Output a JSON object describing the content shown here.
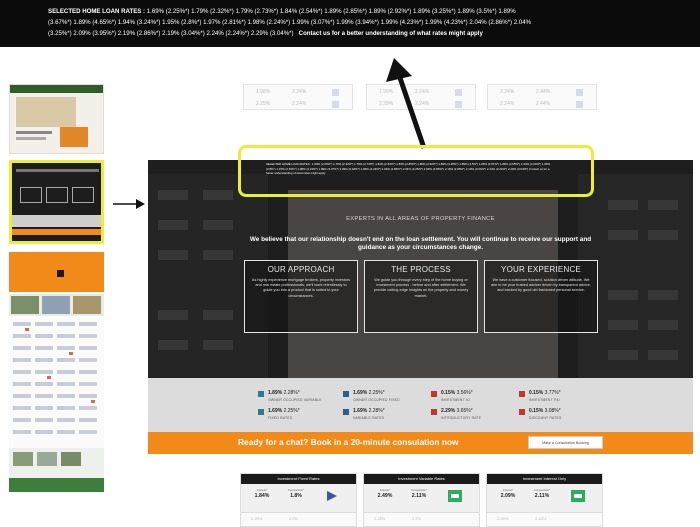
{
  "banner": {
    "label": "SELECTED HOME LOAN RATES :",
    "line1": "1.69% (2.25%*)   1.79% (2.32%*)   1.79% (2.73%*)   1.84% (2.54%*)   1.89% (2.85%*)   1.89% (2.92%*)   1.89% (3.25%*)   1.89% (3.5%*)   1.89%",
    "line2": "(3.67%*)   1.89% (4.65%*)   1.94% (3.24%*)   1.95% (2.8%*)   1.97% (2.81%*)   1.98% (2.24%*)   1.99% (3.07%*)   1.99% (3.94%*)   1.99% (4.23%*)   1.99% (4.23%*)   2.04% (2.86%*)   2.04%",
    "line3": "(3.25%*)   2.09% (3.95%*)   2.19% (2.86%*)   2.19% (3.04%*)   2.24% (2.24%*)   2.29% (3.04%*)",
    "cta": "Contact us for a better understanding of what rates might apply"
  },
  "faded_widgets": [
    {
      "a": "1.98%",
      "b": "2.24%"
    },
    {
      "a": "1.99%",
      "b": "2.24%"
    },
    {
      "a": "2.24%",
      "b": "2.44%"
    },
    {
      "a": "2.25%",
      "b": "2.24%"
    },
    {
      "a": "2.29%",
      "b": "2.24%"
    },
    {
      "a": "2.24%",
      "b": "2.44%"
    }
  ],
  "hero": {
    "ticker": "SELECTED HOME LOAN RATES : 1.69% (2.25%*)  1.79% (2.32%*)  1.79% (2.73%*)  1.84% (2.54%*)  1.89% (2.85%*)  1.89% (2.92%*)  1.89% (3.25%*)  1.89% (3.5%*)  1.89% (3.67%*)  1.89% (4.65%*)  1.94% (3.24%*)  1.95% (2.8%*)  1.97% (2.81%*)  1.98% (2.24%*)  1.99% (3.07%*)  1.99% (3.94%*)  1.99% (4.23%*)  2.04% (2.86%*)  2.04% (3.25%*)  2.09% (3.95%*)  2.19% (2.86%*)  2.19% (3.04%*)  2.24% (2.24%*)  2.29% (3.04%*)  Contact us for a better understanding of what rates might apply",
    "kicker": "EXPERTS IN ALL AREAS OF PROPERTY FINANCE",
    "title": "We believe that our relationship doesn't end on the loan settlement. You will continue to receive our support and guidance as your circumstances change."
  },
  "cards": [
    {
      "heading": "OUR APPROACH",
      "body": "As highly experience mortgage brokers, property investors and real estate professionals, we'll work relentlessly to guide you into a product that is suited to your circumstances."
    },
    {
      "heading": "THE PROCESS",
      "body": "We guide you through every step of the home buying or investment process - before and after settlement. We provide cutting edge insights on the property and money market."
    },
    {
      "heading": "YOUR EXPERIENCE",
      "body": "We have a customer focused, solution driven attitude. We aim to be your trusted adviser driven by transparent advice, and backed by good old fashioned personal service."
    }
  ],
  "rates": [
    {
      "rate": "1.89%",
      "comp": "2.28%*",
      "label": "OWNER OCCUPIED VARIABLE",
      "color": "#2d7a8c"
    },
    {
      "rate": "1.69%",
      "comp": "2.25%*",
      "label": "OWNER OCCUPIED FIXED",
      "color": "#2d5f8c"
    },
    {
      "rate": "0.15%",
      "comp": "3.56%*",
      "label": "INVESTMENT IO",
      "color": "#c0392b"
    },
    {
      "rate": "0.15%",
      "comp": "3.77%*",
      "label": "INVESTMENT P&I",
      "color": "#c0392b"
    },
    {
      "rate": "1.69%",
      "comp": "2.25%*",
      "label": "FIXED RATES",
      "color": "#2d7a8c"
    },
    {
      "rate": "1.69%",
      "comp": "2.28%*",
      "label": "VARIABLE RATES",
      "color": "#2d5f8c"
    },
    {
      "rate": "2.29%",
      "comp": "3.65%*",
      "label": "INTRODUCTORY RATE",
      "color": "#c0392b"
    },
    {
      "rate": "0.15%",
      "comp": "3.08%*",
      "label": "DISCOUNT RATES",
      "color": "#c0392b"
    }
  ],
  "cta_bar": {
    "text": "Ready for a chat? Book in a 20-minute consulation now",
    "button": "Make a Consultation Booking"
  },
  "bottom_widgets": [
    {
      "title": "Investment Fixed Rates",
      "col1": "Interest*",
      "col2": "Comparison*",
      "v1": "1.84%",
      "v2": "1.8%",
      "r1": "2.25%",
      "r2": "2.2%",
      "logo_color": "#3b5998"
    },
    {
      "title": "Investment Variable Rates",
      "col1": "Interest*",
      "col2": "Comparison*",
      "v1": "2.49%",
      "v2": "2.11%",
      "r1": "2.25%",
      "r2": "2.2%",
      "logo_color": "#27ae60"
    },
    {
      "title": "Investment Interest Only",
      "col1": "Interest*",
      "col2": "Comparison*",
      "v1": "2.09%",
      "v2": "2.11%",
      "r1": "2.09%",
      "r2": "2.44%",
      "logo_color": "#27ae60"
    }
  ]
}
